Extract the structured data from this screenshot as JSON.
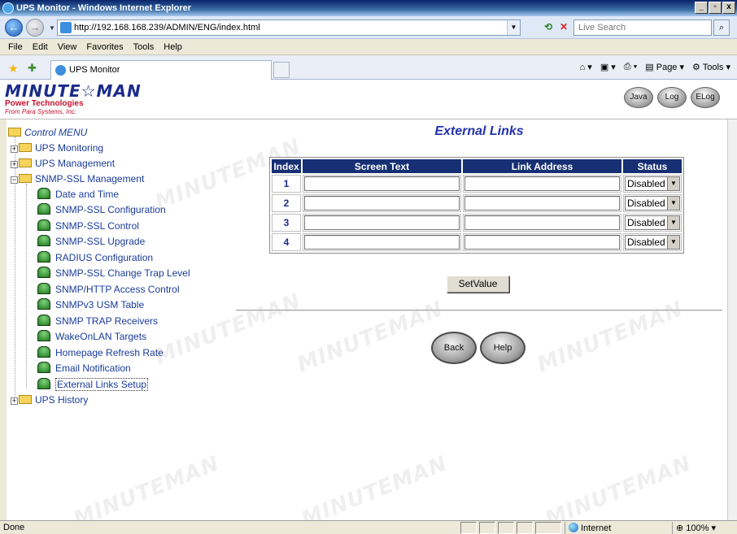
{
  "window": {
    "title": "UPS Monitor - Windows Internet Explorer",
    "controls": [
      "_",
      "▫",
      "x"
    ]
  },
  "address_bar": {
    "url": "http://192.168.168.239/ADMIN/ENG/index.html",
    "search_placeholder": "Live Search"
  },
  "menu": [
    "File",
    "Edit",
    "View",
    "Favorites",
    "Tools",
    "Help"
  ],
  "tab": {
    "title": "UPS Monitor"
  },
  "command_bar": {
    "page_label": "Page",
    "tools_label": "Tools"
  },
  "banner": {
    "logo_line1": "MINUTE☆MAN",
    "logo_line2": "Power Technologies",
    "logo_line3": "From Para Systems, Inc.",
    "buttons": [
      "Java",
      "Log",
      "ELog"
    ]
  },
  "sidebar": {
    "root": "Control MENU",
    "items": [
      {
        "label": "UPS Monitoring"
      },
      {
        "label": "UPS Management"
      },
      {
        "label": "SNMP-SSL Management"
      },
      {
        "label": "Date and Time"
      },
      {
        "label": "SNMP-SSL Configuration"
      },
      {
        "label": "SNMP-SSL Control"
      },
      {
        "label": "SNMP-SSL Upgrade"
      },
      {
        "label": "RADIUS Configuration"
      },
      {
        "label": "SNMP-SSL Change Trap Level"
      },
      {
        "label": "SNMP/HTTP Access Control"
      },
      {
        "label": "SNMPv3 USM Table"
      },
      {
        "label": "SNMP TRAP Receivers"
      },
      {
        "label": "WakeOnLAN Targets"
      },
      {
        "label": "Homepage Refresh Rate"
      },
      {
        "label": "Email Notification"
      },
      {
        "label": "External Links Setup"
      },
      {
        "label": "UPS History"
      }
    ]
  },
  "main": {
    "title": "External Links",
    "table": {
      "headers": [
        "Index",
        "Screen Text",
        "Link Address",
        "Status"
      ],
      "rows": [
        {
          "index": "1",
          "screen_text": "",
          "link_address": "",
          "status": "Disabled"
        },
        {
          "index": "2",
          "screen_text": "",
          "link_address": "",
          "status": "Disabled"
        },
        {
          "index": "3",
          "screen_text": "",
          "link_address": "",
          "status": "Disabled"
        },
        {
          "index": "4",
          "screen_text": "",
          "link_address": "",
          "status": "Disabled"
        }
      ]
    },
    "set_value_label": "SetValue",
    "back_label": "Back",
    "help_label": "Help"
  },
  "status_bar": {
    "text": "Done",
    "zone": "Internet",
    "zoom": "100%"
  },
  "icons": {
    "nav_back": "back-arrow-icon",
    "nav_forward": "forward-arrow-icon",
    "folder": "folder-icon",
    "ups_item": "ups-device-icon"
  },
  "colors": {
    "title_blue": "#2333aa",
    "header_navy": "#163073",
    "link_blue": "#1a3c9a"
  }
}
